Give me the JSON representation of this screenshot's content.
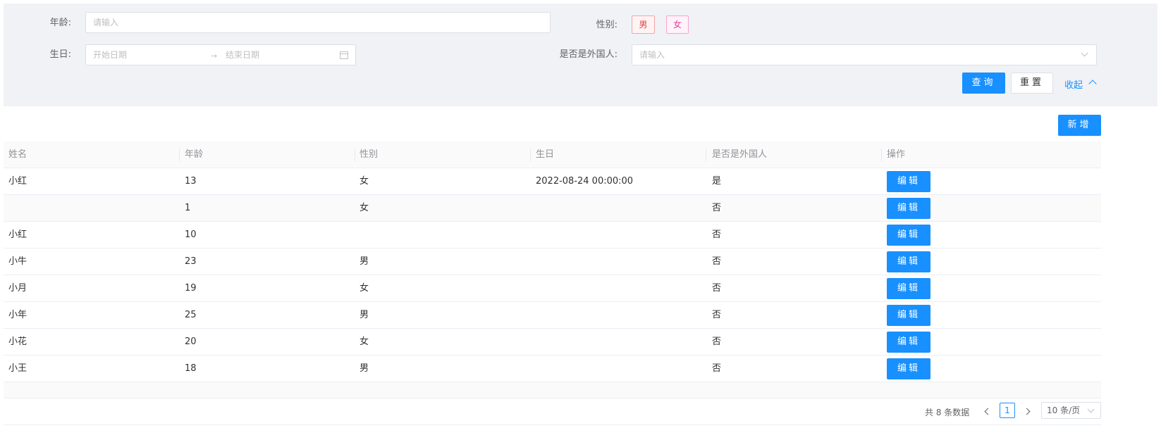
{
  "filter": {
    "age_label": "年龄:",
    "age_placeholder": "请输入",
    "gender_label": "性别:",
    "gender_tags": [
      "男",
      "女"
    ],
    "birthday_label": "生日:",
    "start_date_placeholder": "开始日期",
    "end_date_placeholder": "结束日期",
    "foreigner_label": "是否是外国人:",
    "foreigner_placeholder": "请输入",
    "query_button": "查询",
    "reset_button": "重置",
    "collapse_link": "收起"
  },
  "toolbar": {
    "add_button": "新增"
  },
  "table": {
    "columns": [
      "姓名",
      "年龄",
      "性别",
      "生日",
      "是否是外国人",
      "操作"
    ],
    "rows": [
      [
        "小红",
        "13",
        "女",
        "2022-08-24 00:00:00",
        "是"
      ],
      [
        "",
        "1",
        "女",
        "",
        "否"
      ],
      [
        "小红",
        "10",
        "",
        "",
        "否"
      ],
      [
        "小牛",
        "23",
        "男",
        "",
        "否"
      ],
      [
        "小月",
        "19",
        "女",
        "",
        "否"
      ],
      [
        "小年",
        "25",
        "男",
        "",
        "否"
      ],
      [
        "小花",
        "20",
        "女",
        "",
        "否"
      ],
      [
        "小王",
        "18",
        "男",
        "",
        "否"
      ]
    ],
    "edit_label": "编辑"
  },
  "pagination": {
    "total_text": "共 8 条数据",
    "current_page": "1",
    "page_size": "10 条/页"
  },
  "colors": {
    "primary": "#1890ff",
    "panel_bg": "#f0f2f5",
    "tag_male": "#e04040",
    "tag_female": "#e0409a"
  }
}
